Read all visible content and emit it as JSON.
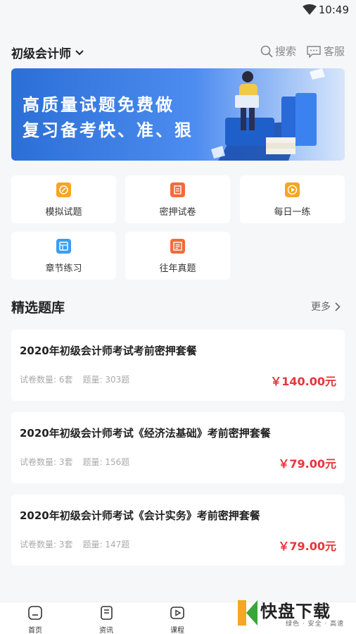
{
  "status_bar": {
    "time": "10:49"
  },
  "header": {
    "course": "初级会计师",
    "search_label": "搜索",
    "service_label": "客服"
  },
  "banner": {
    "line1": "高质量试题免费做",
    "line2": "复习备考快、准、狠"
  },
  "tools": [
    {
      "label": "模拟试题",
      "icon": "mock-exam-icon",
      "color": "#f5a623"
    },
    {
      "label": "密押试卷",
      "icon": "secret-paper-icon",
      "color": "#f26b3a"
    },
    {
      "label": "每日一练",
      "icon": "daily-practice-icon",
      "color": "#f5a623"
    },
    {
      "label": "章节练习",
      "icon": "chapter-practice-icon",
      "color": "#3a9df2"
    },
    {
      "label": "往年真题",
      "icon": "past-exam-icon",
      "color": "#f26b3a"
    }
  ],
  "section": {
    "title": "精选题库",
    "more": "更多"
  },
  "packages": [
    {
      "name": "2020年初级会计师考试考前密押套餐",
      "papers": "试卷数量: 6套",
      "questions": "题量: 303题",
      "price": "￥140.00元"
    },
    {
      "name": "2020年初级会计师考试《经济法基础》考前密押套餐",
      "papers": "试卷数量: 3套",
      "questions": "题量: 156题",
      "price": "￥79.00元"
    },
    {
      "name": "2020年初级会计师考试《会计实务》考前密押套餐",
      "papers": "试卷数量: 3套",
      "questions": "题量: 147题",
      "price": "￥79.00元"
    }
  ],
  "tabs": [
    {
      "label": "首页",
      "icon": "home-icon"
    },
    {
      "label": "资讯",
      "icon": "news-icon"
    },
    {
      "label": "课程",
      "icon": "course-icon"
    }
  ],
  "watermark": {
    "brand": "快盘下载",
    "tagline": "绿色 · 安全 · 高速"
  },
  "colors": {
    "accent": "#2b6fd6",
    "price": "#e8353b"
  }
}
